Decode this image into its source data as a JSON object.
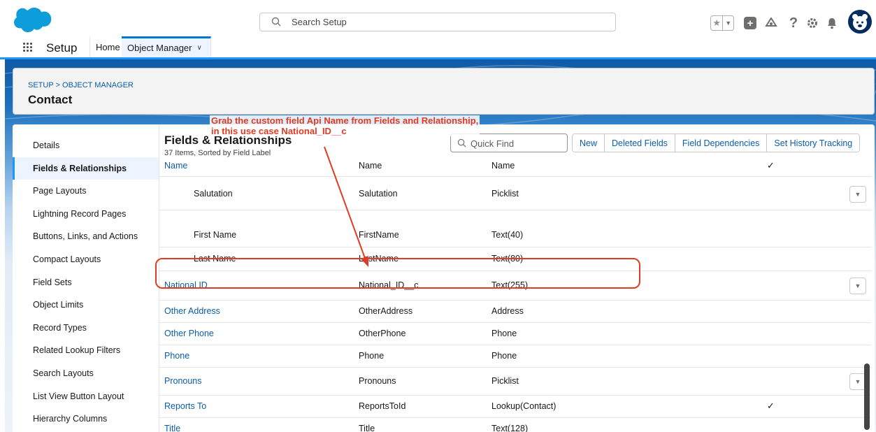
{
  "header": {
    "search_placeholder": "Search Setup"
  },
  "nav": {
    "app_name": "Setup",
    "home": "Home",
    "object_manager": "Object Manager"
  },
  "page": {
    "breadcrumb": "SETUP > OBJECT MANAGER",
    "object_name": "Contact"
  },
  "sidebar": {
    "items": [
      {
        "label": "Details"
      },
      {
        "label": "Fields & Relationships"
      },
      {
        "label": "Page Layouts"
      },
      {
        "label": "Lightning Record Pages"
      },
      {
        "label": "Buttons, Links, and Actions"
      },
      {
        "label": "Compact Layouts"
      },
      {
        "label": "Field Sets"
      },
      {
        "label": "Object Limits"
      },
      {
        "label": "Record Types"
      },
      {
        "label": "Related Lookup Filters"
      },
      {
        "label": "Search Layouts"
      },
      {
        "label": "List View Button Layout"
      },
      {
        "label": "Hierarchy Columns"
      }
    ],
    "active_index": 1
  },
  "content": {
    "title": "Fields & Relationships",
    "subtitle": "37 Items, Sorted by Field Label",
    "quick_find_placeholder": "Quick Find",
    "buttons": {
      "new": "New",
      "deleted_fields": "Deleted Fields",
      "field_dependencies": "Field Dependencies",
      "set_history_tracking": "Set History Tracking"
    },
    "rows": [
      {
        "label": "Name",
        "api": "Name",
        "type": "Name",
        "indexed": "✓",
        "link": true,
        "indent": false,
        "menu": false
      },
      {
        "label": "Salutation",
        "api": "Salutation",
        "type": "Picklist",
        "indexed": "",
        "link": false,
        "indent": true,
        "menu": true
      },
      {
        "label": "First Name",
        "api": "FirstName",
        "type": "Text(40)",
        "indexed": "",
        "link": false,
        "indent": true,
        "menu": false
      },
      {
        "label": "Last Name",
        "api": "LastName",
        "type": "Text(80)",
        "indexed": "",
        "link": false,
        "indent": true,
        "menu": false
      },
      {
        "label": "National ID",
        "api": "National_ID__c",
        "type": "Text(255)",
        "indexed": "",
        "link": true,
        "indent": false,
        "menu": true
      },
      {
        "label": "Other Address",
        "api": "OtherAddress",
        "type": "Address",
        "indexed": "",
        "link": true,
        "indent": false,
        "menu": false
      },
      {
        "label": "Other Phone",
        "api": "OtherPhone",
        "type": "Phone",
        "indexed": "",
        "link": true,
        "indent": false,
        "menu": false
      },
      {
        "label": "Phone",
        "api": "Phone",
        "type": "Phone",
        "indexed": "",
        "link": true,
        "indent": false,
        "menu": false
      },
      {
        "label": "Pronouns",
        "api": "Pronouns",
        "type": "Picklist",
        "indexed": "",
        "link": true,
        "indent": false,
        "menu": true
      },
      {
        "label": "Reports To",
        "api": "ReportsToId",
        "type": "Lookup(Contact)",
        "indexed": "✓",
        "link": true,
        "indent": false,
        "menu": false
      },
      {
        "label": "Title",
        "api": "Title",
        "type": "Text(128)",
        "indexed": "",
        "link": true,
        "indent": false,
        "menu": false
      }
    ]
  },
  "annotation": {
    "line1": "Grab the custom field Api Name from Fields and Relationship,",
    "line2": "in this use case National_ID__c",
    "color": "#e03b24"
  },
  "colors": {
    "brand": "#0176d3",
    "link": "#0b5cab",
    "header_bg": "#032d60"
  },
  "icons": [
    "salesforce-cloud-logo",
    "search-icon",
    "star-icon",
    "chevron-down-icon",
    "plus-icon",
    "trailhead-icon",
    "help-icon",
    "gear-icon",
    "bell-icon",
    "avatar-icon",
    "app-launcher-icon"
  ]
}
